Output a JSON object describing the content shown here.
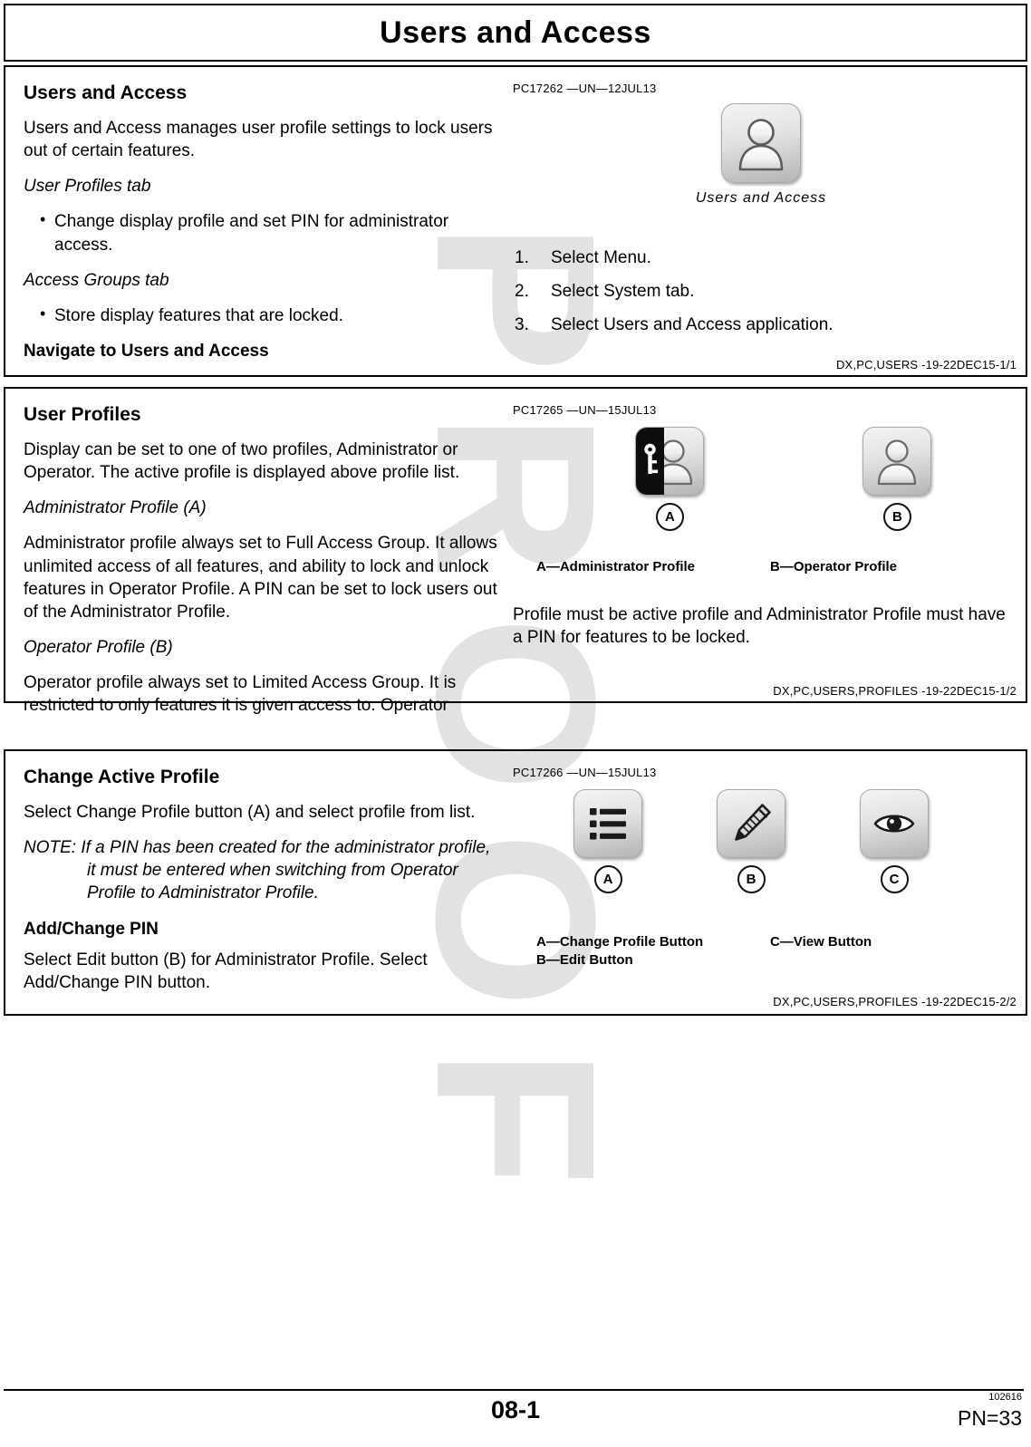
{
  "page": {
    "title": "Users and Access",
    "footer": {
      "page_number": "08-1",
      "doc_number": "102616",
      "pn": "PN=33"
    },
    "watermark": "PROOF"
  },
  "sections": [
    {
      "heading": "Users and Access",
      "intro": "Users and Access manages user profile settings to lock users out of certain features.",
      "sub_head_1": "User Profiles tab",
      "bullets_1": [
        "Change display profile and set PIN for administrator access."
      ],
      "sub_head_2": "Access Groups tab",
      "bullets_2": [
        "Store display features that are locked."
      ],
      "nav_head": "Navigate to Users and Access",
      "figure": {
        "id": "PC17262 —UN—12JUL13",
        "caption": "Users and Access",
        "icon": "user-app-icon"
      },
      "steps": [
        "Select Menu.",
        "Select System tab.",
        "Select Users and Access application."
      ],
      "reference": "DX,PC,USERS  -19-22DEC15-1/1"
    },
    {
      "heading": "User Profiles",
      "intro": "Display can be set to one of two profiles, Administrator or Operator. The active profile is displayed above profile list.",
      "sub_head_1": "Administrator Profile (A)",
      "para_1": "Administrator profile always set to Full Access Group. It allows unlimited access of all features, and ability to lock and unlock features in Operator Profile. A PIN can be set to lock users out of the Administrator Profile.",
      "sub_head_2": "Operator Profile (B)",
      "para_2": "Operator profile always set to Limited Access Group. It is restricted to only features it is given access to. Operator",
      "figure": {
        "id": "PC17265 —UN—15JUL13",
        "items": [
          {
            "callout": "A",
            "icon": "admin-profile-icon"
          },
          {
            "callout": "B",
            "icon": "operator-profile-icon"
          }
        ],
        "legend": [
          "A—Administrator Profile",
          "B—Operator Profile"
        ]
      },
      "right_para": "Profile must be active profile and Administrator Profile must have a PIN for features to be locked.",
      "reference": "DX,PC,USERS,PROFILES  -19-22DEC15-1/2"
    },
    {
      "heading": "Change Active Profile",
      "intro": "Select Change Profile button (A) and select profile from list.",
      "note": "NOTE: If a PIN has been created for the administrator profile, it must be entered when switching from Operator Profile to Administrator Profile.",
      "sub_head_2": "Add/Change PIN",
      "para_2": "Select Edit button (B) for Administrator Profile. Select Add/Change PIN button.",
      "figure": {
        "id": "PC17266 —UN—15JUL13",
        "items": [
          {
            "callout": "A",
            "icon": "list-menu-icon"
          },
          {
            "callout": "B",
            "icon": "pencil-edit-icon"
          },
          {
            "callout": "C",
            "icon": "eye-view-icon"
          }
        ],
        "legend_left": [
          "A—Change Profile Button",
          "B—Edit Button"
        ],
        "legend_right": [
          "C—View Button"
        ]
      },
      "reference": "DX,PC,USERS,PROFILES  -19-22DEC15-2/2"
    }
  ]
}
